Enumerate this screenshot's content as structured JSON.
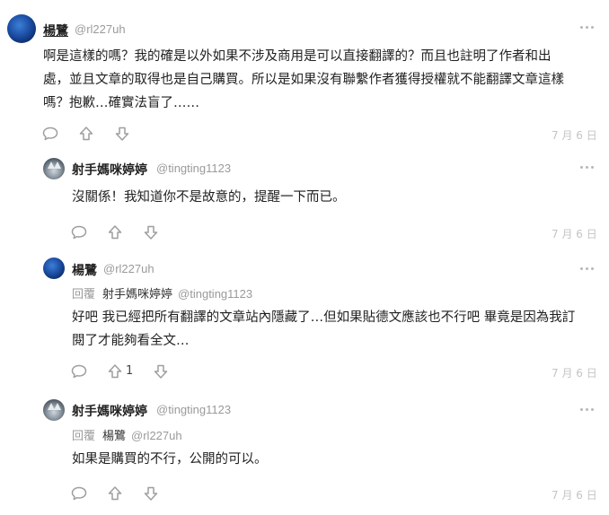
{
  "comments": [
    {
      "name": "楊鷺",
      "handle": "@rl227uh",
      "body_lines": [
        "啊是這樣的嗎？我的確是以外如果不涉及商用是可以直接翻譯的？而且也註明了作者和出",
        "處，並且文章的取得也是自己購買。所以是如果沒有聯繫作者獲得授權就不能翻譯文章這樣",
        "嗎？抱歉…確實法盲了……"
      ],
      "date": "7 月 6 日"
    },
    {
      "name": "射手媽咪婷婷",
      "handle": "@tingting1123",
      "body_lines": [
        "沒關係！我知道你不是故意的，提醒一下而已。"
      ],
      "date": "7 月 6 日"
    },
    {
      "name": "楊鷺",
      "handle": "@rl227uh",
      "reply_label": "回覆",
      "reply_name": "射手媽咪婷婷",
      "reply_handle": "@tingting1123",
      "body_lines": [
        "好吧 我已經把所有翻譯的文章站內隱藏了…但如果貼德文應該也不行吧 畢竟是因為我訂",
        "閱了才能夠看全文…"
      ],
      "upvotes": "1",
      "date": "7 月 6 日"
    },
    {
      "name": "射手媽咪婷婷",
      "handle": "@tingting1123",
      "reply_label": "回覆",
      "reply_name": "楊鷺",
      "reply_handle": "@rl227uh",
      "body_lines": [
        "如果是購買的不行，公開的可以。"
      ],
      "date": "7 月 6 日"
    }
  ],
  "icons": [
    "comment-icon",
    "upvote-icon",
    "downvote-icon",
    "more-options-icon"
  ]
}
